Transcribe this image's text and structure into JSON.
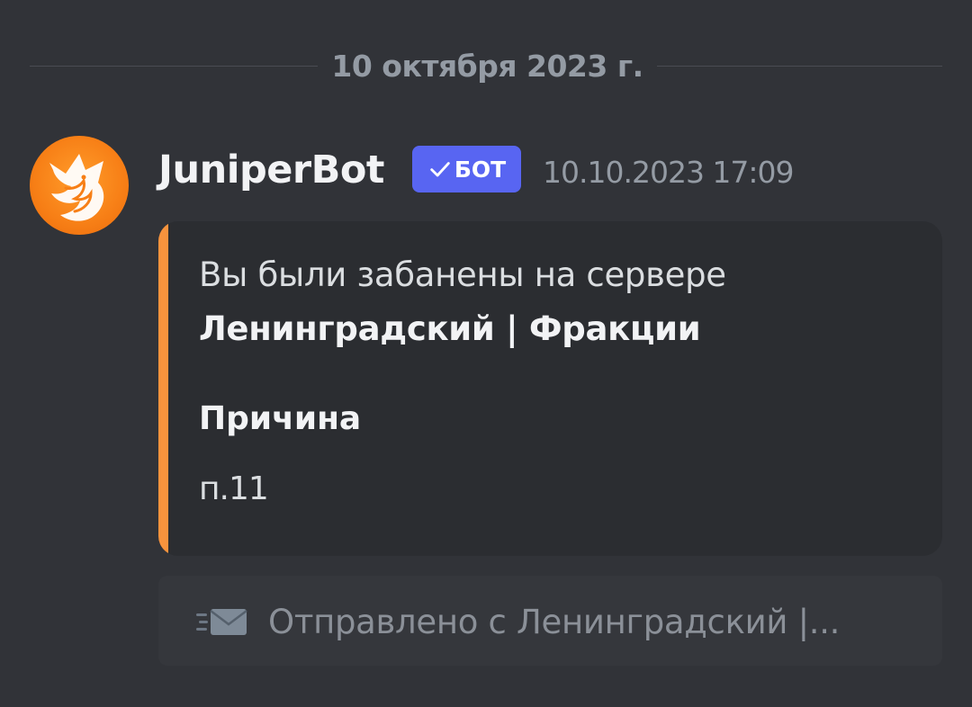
{
  "divider": {
    "date_label": "10 октября 2023 г."
  },
  "message": {
    "author": "JuniperBot",
    "bot_tag": "БОТ",
    "bot_tag_icon": "checkmark-icon",
    "avatar_icon": "fox-logo-icon",
    "timestamp": "10.10.2023 17:09",
    "embed": {
      "accent_color": "#f6933d",
      "description_line1": "Вы были забанены на сервере",
      "description_bold": "Ленинградский | Фракции",
      "field": {
        "name": "Причина",
        "value": "п.11"
      }
    }
  },
  "footer": {
    "icon": "envelope-icon",
    "text": "Отправлено с Ленинградский |..."
  },
  "colors": {
    "background": "#313338",
    "bot_tag": "#5865f2",
    "embed_bg": "#2b2d31",
    "muted_text": "#949ba4"
  }
}
